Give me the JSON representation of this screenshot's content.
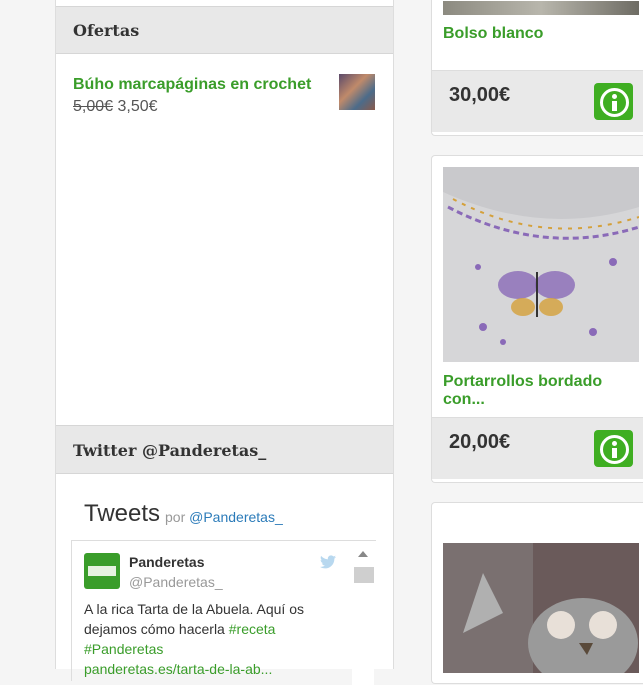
{
  "offers_widget": {
    "title": "Ofertas",
    "item": {
      "name": "Búho marcapáginas en crochet",
      "old_price": "5,00€",
      "new_price": "3,50€",
      "thumb_icon": "owl-bookmark-thumbnail"
    }
  },
  "twitter_widget": {
    "title": "Twitter @Panderetas_",
    "feed_title": "Tweets",
    "by": "por",
    "by_handle": "@Panderetas_",
    "tweet": {
      "name": "Panderetas",
      "handle": "@Panderetas_",
      "text_before": "A la rica Tarta de la Abuela. Aquí os dejamos cómo hacerla ",
      "hashtag1": "#receta",
      "hashtag2": "#Panderetas",
      "link": "panderetas.es/tarta-de-la-ab..."
    }
  },
  "products": [
    {
      "name": "Bolso blanco",
      "price": "30,00€",
      "image": "white-bag-photo"
    },
    {
      "name_line1": "Portarrollos bordado",
      "name_line2": "con...",
      "price": "20,00€",
      "image": "embroidered-butterfly-photo"
    },
    {
      "image": "crochet-owl-hat-photo"
    }
  ],
  "colors": {
    "accent_green": "#3a9d2a",
    "button_green": "#3fae22",
    "twitter_blue": "#2b7bb9"
  }
}
